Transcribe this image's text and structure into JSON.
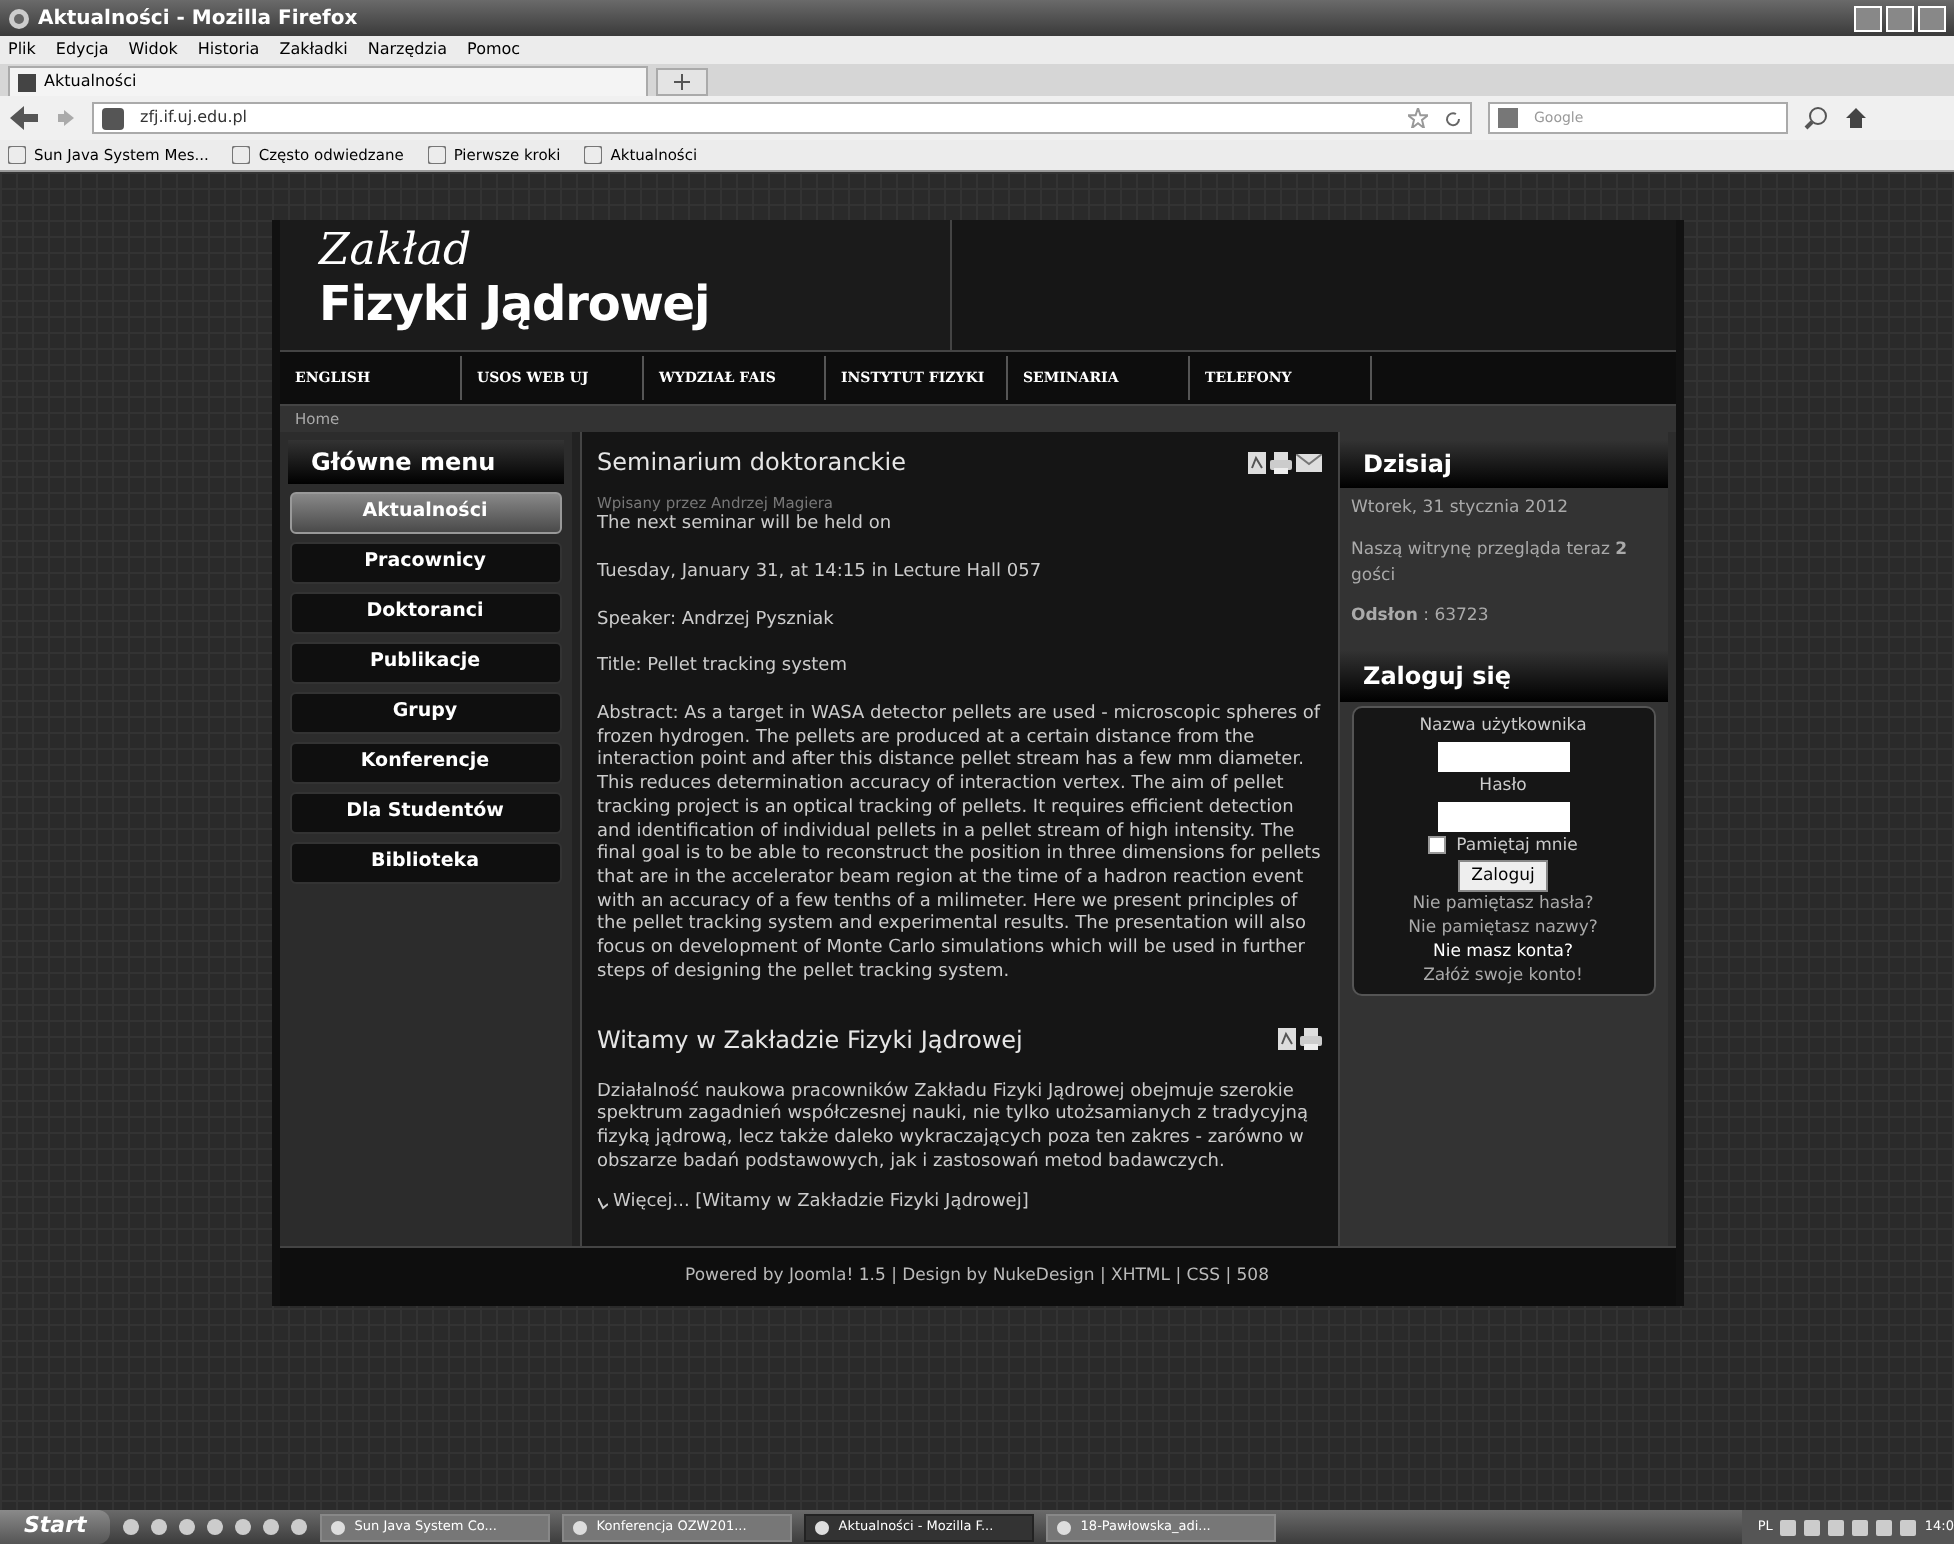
{
  "window": {
    "title": "Aktualności - Mozilla Firefox"
  },
  "menu_bar": [
    "Plik",
    "Edycja",
    "Widok",
    "Historia",
    "Zakładki",
    "Narzędzia",
    "Pomoc"
  ],
  "browser_tab": {
    "label": "Aktualności"
  },
  "address_bar": {
    "url": "zfj.if.uj.edu.pl"
  },
  "search_field": {
    "placeholder": "Google"
  },
  "bookmarks": [
    "Sun Java System Mes...",
    "Często odwiedzane",
    "Pierwsze kroki",
    "Aktualności"
  ],
  "site": {
    "logo_top": "Zakład",
    "logo_bottom": "Fizyki Jądrowej",
    "nav": [
      "ENGLISH",
      "USOS WEB UJ",
      "WYDZIAŁ FAIS",
      "INSTYTUT FIZYKI",
      "SEMINARIA",
      "TELEFONY"
    ],
    "breadcrumb": "Home"
  },
  "main_menu": {
    "title": "Główne menu",
    "items": [
      {
        "label": "Aktualności",
        "selected": true
      },
      {
        "label": "Pracownicy",
        "selected": false
      },
      {
        "label": "Doktoranci",
        "selected": false
      },
      {
        "label": "Publikacje",
        "selected": false
      },
      {
        "label": "Grupy",
        "selected": false
      },
      {
        "label": "Konferencje",
        "selected": false
      },
      {
        "label": "Dla Studentów",
        "selected": false
      },
      {
        "label": "Biblioteka",
        "selected": false
      }
    ]
  },
  "articles": [
    {
      "title": "Seminarium doktoranckie",
      "icons": [
        {
          "kind": "pdf"
        },
        {
          "kind": "print"
        },
        {
          "kind": "email"
        }
      ],
      "author": "Wpisany przez Andrzej Magiera",
      "paragraphs": [
        "The next seminar will be held on",
        "Tuesday, January 31, at 14:15 in Lecture Hall 057",
        "Speaker: Andrzej Pyszniak",
        "Title: Pellet tracking system",
        "Abstract: As a target in WASA detector pellets are used - microscopic spheres of frozen hydrogen. The pellets are produced at a certain distance from the interaction point and after this distance pellet stream has a few mm diameter. This reduces determination accuracy of interaction vertex. The aim of pellet tracking project is an optical tracking of pellets. It requires efficient detection and identification of individual pellets in a pellet stream of high intensity. The final goal is to be able to reconstruct the position in three dimensions for pellets that are in the accelerator beam region at the time of a hadron reaction event with an accuracy of a few tenths of a milimeter. Here we present principles of the pellet tracking system and experimental results. The presentation will also focus on development of Monte Carlo simulations which will be used in further steps of designing the pellet tracking system."
      ]
    },
    {
      "title": "Witamy w Zakładzie Fizyki Jądrowej",
      "icons": [
        {
          "kind": "pdf"
        },
        {
          "kind": "print"
        }
      ],
      "paragraphs": [
        "Działalność naukowa pracowników Zakładu Fizyki Jądrowej obejmuje szerokie spektrum zagadnień współczesnej nauki, nie tylko utożsamianych z tradycyjną fizyką jądrową, lecz także daleko wykraczających poza ten zakres - zarówno w obszarze badań podstawowych, jak i zastosowań metod badawczych."
      ],
      "more_link": "Więcej... [Witamy w Zakładzie Fizyki Jądrowej]"
    }
  ],
  "today": {
    "title": "Dzisiaj",
    "date": "Wtorek, 31 stycznia 2012",
    "visitors": "Naszą witrynę przegląda teraz **2** gości",
    "hits": "**Odsłon** : 63723"
  },
  "login": {
    "title": "Zaloguj się",
    "username_label": "Nazwa użytkownika",
    "password_label": "Hasło",
    "remember": {
      "label": "Pamiętaj mnie",
      "checked": false
    },
    "button": "Zaloguj",
    "links": [
      "Nie pamiętasz hasła?",
      "Nie pamiętasz nazwy?"
    ],
    "no_account": "Nie masz konta?",
    "register": "Załóż swoje konto!"
  },
  "footer": "Powered by Joomla! 1.5 | Design by NukeDesign | XHTML | CSS | 508",
  "taskbar": {
    "start": "Start",
    "windows": [
      {
        "label": "Sun Java System Co...",
        "selected": false
      },
      {
        "label": "Konferencja OZW201...",
        "selected": false
      },
      {
        "label": "Aktualności - Mozilla F...",
        "selected": true
      },
      {
        "label": "18-Pawłowska_adi...",
        "selected": false
      }
    ],
    "language": "PL",
    "clock": "14:0"
  }
}
